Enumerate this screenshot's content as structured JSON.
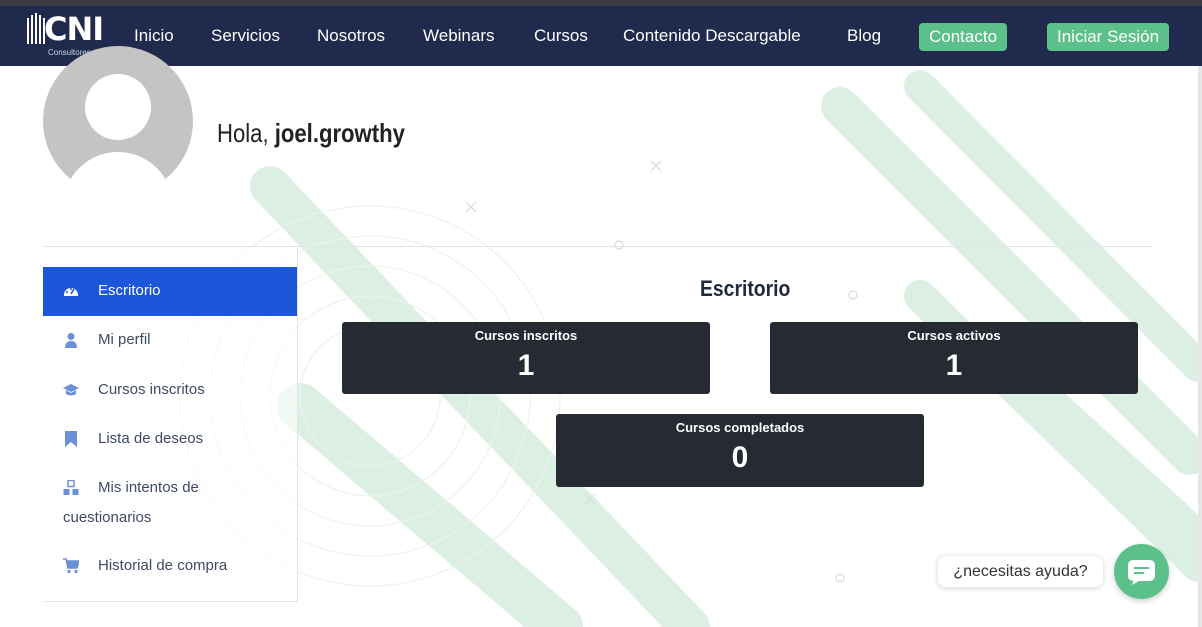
{
  "nav": {
    "logo_text": "CNI",
    "logo_sub": "Consultores",
    "items": [
      "Inicio",
      "Servicios",
      "Nosotros",
      "Webinars",
      "Cursos",
      "Contenido Descargable",
      "Blog"
    ],
    "contact_label": "Contacto",
    "login_label": "Iniciar Sesión"
  },
  "profile": {
    "greeting": "Hola,",
    "username": "joel.growthy"
  },
  "sidebar": {
    "items": [
      {
        "label": "Escritorio",
        "icon": "dashboard-icon"
      },
      {
        "label": "Mi perfil",
        "icon": "user-icon"
      },
      {
        "label": "Cursos inscritos",
        "icon": "graduation-cap-icon"
      },
      {
        "label": "Lista de deseos",
        "icon": "bookmark-icon"
      },
      {
        "label": "Mis intentos de",
        "label2": "cuestionarios",
        "icon": "cubes-icon"
      },
      {
        "label": "Historial de compra",
        "icon": "cart-icon"
      }
    ]
  },
  "dashboard": {
    "title": "Escritorio",
    "cards": [
      {
        "label": "Cursos inscritos",
        "value": "1"
      },
      {
        "label": "Cursos activos",
        "value": "1"
      },
      {
        "label": "Cursos completados",
        "value": "0"
      }
    ]
  },
  "chat": {
    "help_text": "¿necesitas ayuda?"
  },
  "colors": {
    "nav_bg": "#1f2a4d",
    "accent_green": "#5cc08a",
    "active_blue": "#1c56d9",
    "card_bg": "#252a33"
  }
}
